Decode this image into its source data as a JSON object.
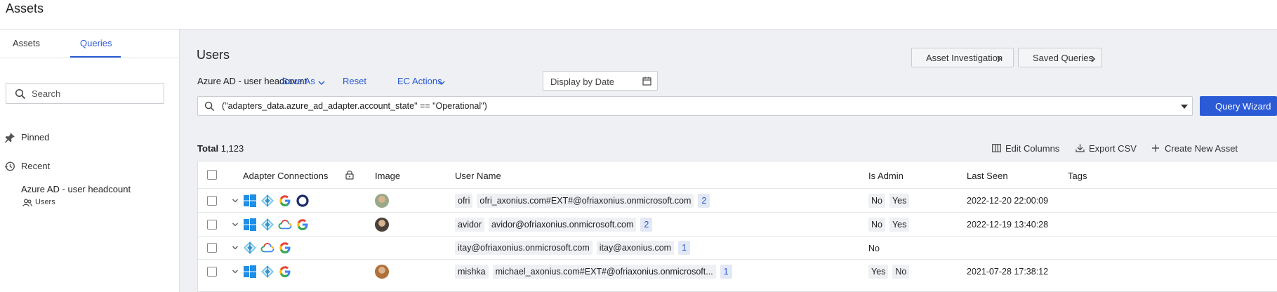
{
  "app": {
    "title": "Assets"
  },
  "sidebar": {
    "tabs": [
      {
        "label": "Assets"
      },
      {
        "label": "Queries"
      }
    ],
    "active_tab": "Queries",
    "search": {
      "placeholder": "Search",
      "value": ""
    },
    "pinned_label": "Pinned",
    "recent_label": "Recent",
    "recent_items": [
      {
        "title": "Azure AD - user headcount",
        "module": "Users"
      }
    ]
  },
  "main": {
    "page_title": "Users",
    "asset_investigation_label": "Asset Investigation",
    "saved_queries_label": "Saved Queries",
    "query_name": "Azure AD - user headcount",
    "save_as_label": "Save As",
    "reset_label": "Reset",
    "ec_actions_label": "EC Actions",
    "date_placeholder": "Display by Date",
    "query_text": "(\"adapters_data.azure_ad_adapter.account_state\" == \"Operational\")",
    "query_wizard_label": "Query Wizard",
    "total_label": "Total",
    "total_count": "1,123",
    "edit_columns_label": "Edit Columns",
    "export_csv_label": "Export CSV",
    "create_asset_label": "Create New Asset"
  },
  "table": {
    "columns": {
      "adapters": "Adapter Connections",
      "image": "Image",
      "user_name": "User Name",
      "is_admin": "Is Admin",
      "last_seen": "Last Seen",
      "tags": "Tags"
    },
    "rows": [
      {
        "adapters": [
          "windows-icon",
          "azure-ad-icon",
          "google-icon",
          "okta-icon"
        ],
        "has_avatar": true,
        "avatar_color": "#9aa88a",
        "user_name": [
          "ofri",
          "ofri_axonius.com#EXT#@ofriaxonius.onmicrosoft.com"
        ],
        "count": "2",
        "is_admin": [
          "No",
          "Yes"
        ],
        "admin_chips": true,
        "last_seen": "2022-12-20 22:00:09"
      },
      {
        "adapters": [
          "windows-icon",
          "azure-ad-icon",
          "gcp-icon",
          "google-icon"
        ],
        "has_avatar": true,
        "avatar_color": "#4a4038",
        "user_name": [
          "avidor",
          "avidor@ofriaxonius.onmicrosoft.com"
        ],
        "count": "2",
        "is_admin": [
          "No",
          "Yes"
        ],
        "admin_chips": true,
        "last_seen": "2022-12-19 13:40:28"
      },
      {
        "adapters": [
          "azure-ad-icon",
          "gcp-icon",
          "google-icon"
        ],
        "has_avatar": false,
        "avatar_color": "",
        "user_name": [
          "itay@ofriaxonius.onmicrosoft.com",
          "itay@axonius.com"
        ],
        "count": "1",
        "is_admin": [
          "No"
        ],
        "admin_chips": false,
        "last_seen": ""
      },
      {
        "adapters": [
          "windows-icon",
          "azure-ad-icon",
          "google-icon"
        ],
        "has_avatar": true,
        "avatar_color": "#b0703a",
        "user_name": [
          "mishka",
          "michael_axonius.com#EXT#@ofriaxonius.onmicrosoft..."
        ],
        "count": "1",
        "is_admin": [
          "Yes",
          "No"
        ],
        "admin_chips": true,
        "last_seen": "2021-07-28 17:38:12"
      }
    ]
  }
}
